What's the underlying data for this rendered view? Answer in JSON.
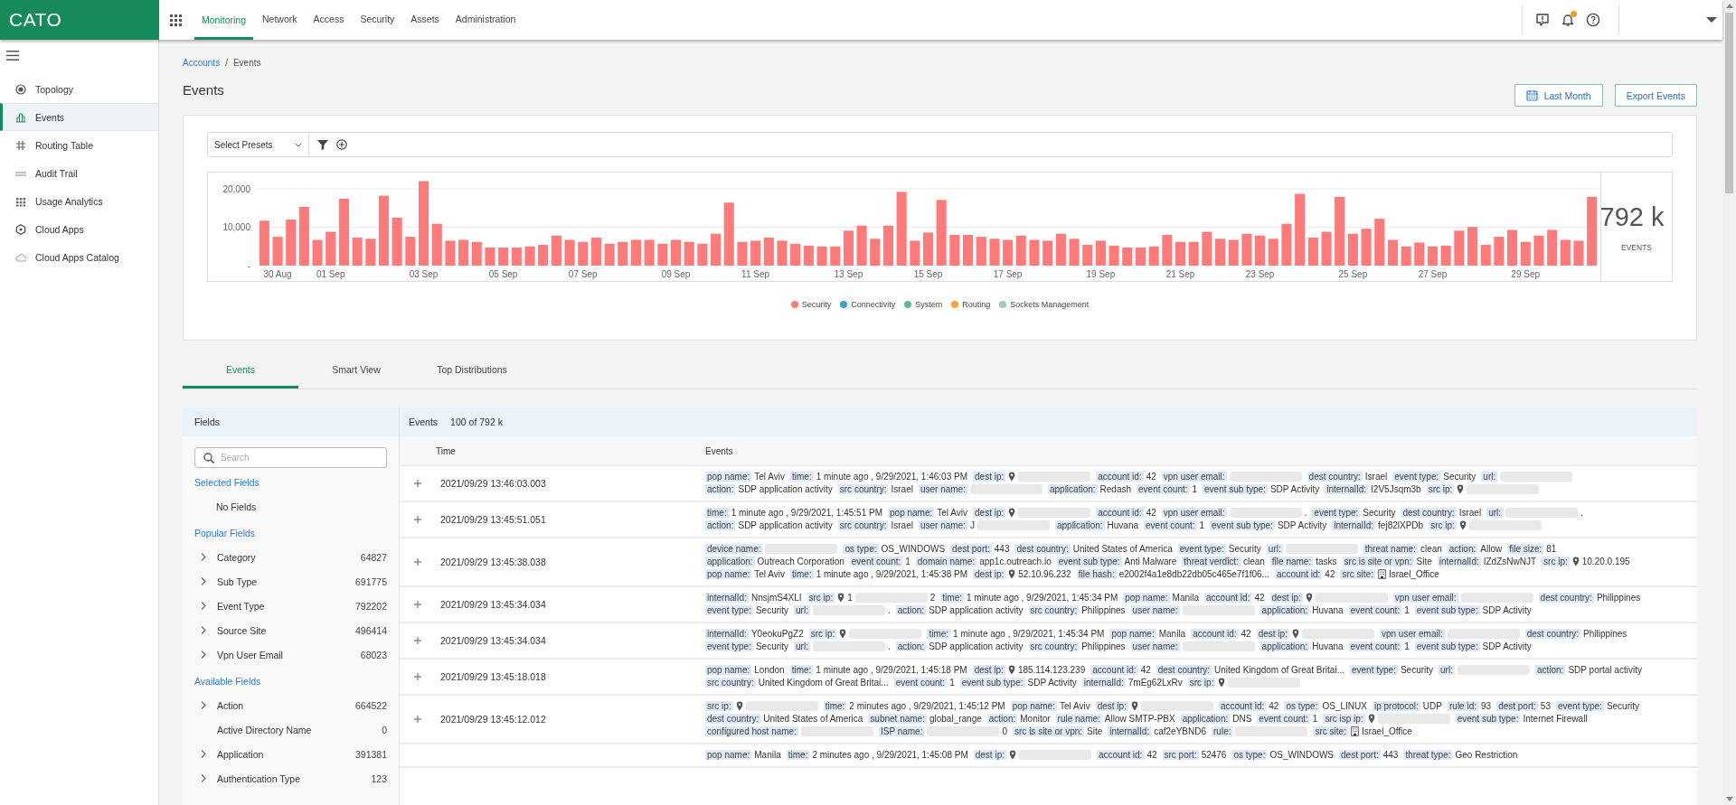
{
  "top_bar": {
    "logo": "CATO",
    "nav": [
      {
        "label": "Monitoring",
        "selected": true
      },
      {
        "label": "Network",
        "selected": false
      },
      {
        "label": "Access",
        "selected": false
      },
      {
        "label": "Security",
        "selected": false
      },
      {
        "label": "Assets",
        "selected": false
      },
      {
        "label": "Administration",
        "selected": false
      }
    ],
    "bell_unread": true
  },
  "sidebar": {
    "items": [
      {
        "label": "Topology",
        "kind": "topology",
        "selected": false
      },
      {
        "label": "Events",
        "kind": "events",
        "selected": true
      },
      {
        "label": "Routing Table",
        "kind": "routing",
        "selected": false
      },
      {
        "label": "Audit Trail",
        "kind": "audit",
        "selected": false
      },
      {
        "label": "Usage Analytics",
        "kind": "usage",
        "selected": false
      },
      {
        "label": "Cloud Apps",
        "kind": "apps",
        "selected": false
      },
      {
        "label": "Cloud Apps Catalog",
        "kind": "catalog",
        "selected": false
      }
    ]
  },
  "breadcrumb": {
    "separator": "/",
    "items": [
      {
        "label": "Accounts",
        "kind": "link"
      },
      {
        "label": "Events",
        "kind": "current"
      }
    ]
  },
  "page_title": "Events",
  "actions": [
    {
      "label": "Last Month",
      "kind": "date"
    },
    {
      "label": "Export Events",
      "kind": "plain"
    }
  ],
  "filter_bar": {
    "preset_select": "Select Presets"
  },
  "chart": {
    "total": "792 k",
    "total_label": "EVENTS",
    "legend_more": [
      {
        "label": "Connectivity",
        "color": "#3f9fcb"
      },
      {
        "label": "System",
        "color": "#5cb8a4"
      },
      {
        "label": "Routing",
        "color": "#f7a431"
      },
      {
        "label": "Sockets Management",
        "color": "#9fcbb8"
      }
    ],
    "chart_data": {
      "type": "bar",
      "categories": [
        null,
        "30 Aug",
        null,
        null,
        null,
        "01 Sep",
        null,
        null,
        null,
        null,
        null,
        null,
        "03 Sep",
        null,
        null,
        null,
        null,
        null,
        "05 Sep",
        null,
        null,
        null,
        null,
        null,
        "07 Sep",
        null,
        null,
        null,
        null,
        null,
        null,
        "09 Sep",
        null,
        null,
        null,
        null,
        null,
        "11 Sep",
        null,
        null,
        null,
        null,
        null,
        null,
        "13 Sep",
        null,
        null,
        null,
        null,
        null,
        "15 Sep",
        null,
        null,
        null,
        null,
        null,
        "17 Sep",
        null,
        null,
        null,
        null,
        null,
        null,
        "19 Sep",
        null,
        null,
        null,
        null,
        null,
        "21 Sep",
        null,
        null,
        null,
        null,
        null,
        "23 Sep",
        null,
        null,
        null,
        null,
        null,
        null,
        "25 Sep",
        null,
        null,
        null,
        null,
        null,
        "27 Sep",
        null,
        null,
        null,
        null,
        null,
        null,
        "29 Sep",
        null,
        null,
        null,
        null,
        null
      ],
      "series": [
        {
          "name": "Security",
          "color": "#ff7b7b",
          "values": [
            11700,
            7500,
            12000,
            15300,
            6700,
            8800,
            17400,
            7300,
            7000,
            18200,
            12500,
            7500,
            22000,
            10900,
            6500,
            6700,
            6200,
            4700,
            4700,
            4700,
            5000,
            5400,
            7800,
            6700,
            6200,
            7300,
            5700,
            6200,
            6700,
            6700,
            5700,
            6700,
            6200,
            5700,
            8300,
            16400,
            6200,
            6500,
            7300,
            6500,
            5700,
            5200,
            5000,
            5000,
            9100,
            10400,
            7000,
            10400,
            19200,
            6500,
            8600,
            17100,
            8000,
            8000,
            7500,
            7000,
            6700,
            7800,
            6700,
            6500,
            8300,
            7000,
            5400,
            6500,
            5200,
            4700,
            4700,
            5000,
            8000,
            6200,
            6200,
            8800,
            7000,
            6700,
            8300,
            7800,
            7000,
            10900,
            18700,
            7300,
            8800,
            17900,
            8300,
            9600,
            12200,
            6700,
            5000,
            6000,
            5000,
            5200,
            9100,
            10100,
            5400,
            7500,
            9300,
            6200,
            7800,
            9300,
            6700,
            6500,
            17900
          ]
        }
      ],
      "ylim": [
        0,
        22000
      ],
      "yticks": [
        {
          "value": 0,
          "label": "-"
        },
        {
          "value": 10000,
          "label": "10,000"
        },
        {
          "value": 20000,
          "label": "20,000"
        }
      ]
    }
  },
  "tabs": [
    {
      "label": "Events",
      "selected": true
    },
    {
      "label": "Smart View",
      "selected": false
    },
    {
      "label": "Top Distributions",
      "selected": false
    }
  ],
  "fields_panel": {
    "title": "Fields",
    "search": {
      "placeholder": "Search"
    },
    "sections": [
      {
        "title": "Selected Fields",
        "empty_text": "No Fields"
      },
      {
        "title": "Popular Fields",
        "items": [
          {
            "name": "Category",
            "count": "64827",
            "expandable": true
          },
          {
            "name": "Sub Type",
            "count": "691775",
            "expandable": true
          },
          {
            "name": "Event Type",
            "count": "792202",
            "expandable": true
          },
          {
            "name": "Source Site",
            "count": "496414",
            "expandable": true
          },
          {
            "name": "Vpn User Email",
            "count": "68023",
            "expandable": true
          }
        ]
      },
      {
        "title": "Available Fields",
        "items": [
          {
            "name": "Action",
            "count": "664522",
            "expandable": true
          },
          {
            "name": "Active Directory Name",
            "count": "0",
            "expandable": false
          },
          {
            "name": "Application",
            "count": "391381",
            "expandable": true
          },
          {
            "name": "Authentication Type",
            "count": "123",
            "expandable": true
          }
        ]
      }
    ]
  },
  "events_panel": {
    "title": "Events",
    "count": "100 of 792 k",
    "columns": [
      "Time",
      "Events"
    ],
    "rows": [
      {
        "time": "2021/09/29 13:46:03.003",
        "tags": [
          {
            "key": "pop name:",
            "kind": "text",
            "value": "Tel Aviv",
            "redacted": false
          },
          {
            "key": "time:",
            "kind": "text",
            "value": "1 minute ago , 9/29/2021, 1:46:03 PM",
            "redacted": false
          },
          {
            "key": "dest ip:",
            "kind": "location",
            "redacted": true
          },
          {
            "key": "account id:",
            "kind": "text",
            "value": "42",
            "redacted": false
          },
          {
            "key": "vpn user email:",
            "kind": "text",
            "redacted": true
          },
          {
            "key": "dest country:",
            "kind": "text",
            "value": "Israel",
            "redacted": false
          },
          {
            "key": "event type:",
            "kind": "text",
            "value": "Security",
            "redacted": false
          },
          {
            "key": "url:",
            "kind": "text",
            "redacted": true
          },
          {
            "key": "action:",
            "kind": "text",
            "value": "SDP application activity",
            "redacted": false
          },
          {
            "key": "src country:",
            "kind": "text",
            "value": "Israel",
            "redacted": false
          },
          {
            "key": "user name:",
            "kind": "text",
            "redacted": true
          },
          {
            "key": "application:",
            "kind": "text",
            "value": "Redash",
            "redacted": false
          },
          {
            "key": "event count:",
            "kind": "text",
            "value": "1",
            "redacted": false
          },
          {
            "key": "event sub type:",
            "kind": "text",
            "value": "SDP Activity",
            "redacted": false
          },
          {
            "key": "internalId:",
            "kind": "text",
            "value": "I2V5Jsqm3b",
            "redacted": false
          },
          {
            "key": "src ip:",
            "kind": "location",
            "redacted": true
          }
        ]
      },
      {
        "time": "2021/09/29 13:45:51.051",
        "tags": [
          {
            "key": "time:",
            "kind": "text",
            "value": "1 minute ago , 9/29/2021, 1:45:51 PM",
            "redacted": false
          },
          {
            "key": "pop name:",
            "kind": "text",
            "value": "Tel Aviv",
            "redacted": false
          },
          {
            "key": "dest ip:",
            "kind": "location",
            "redacted": true
          },
          {
            "key": "account id:",
            "kind": "text",
            "value": "42",
            "redacted": false
          },
          {
            "key": "vpn user email:",
            "kind": "text",
            "redacted": true,
            "tail": "."
          },
          {
            "key": "event type:",
            "kind": "text",
            "value": "Security",
            "redacted": false
          },
          {
            "key": "dest country:",
            "kind": "text",
            "value": "Israel",
            "redacted": false
          },
          {
            "key": "url:",
            "kind": "text",
            "redacted": true,
            "tail": "."
          },
          {
            "key": "action:",
            "kind": "text",
            "value": "SDP application activity",
            "redacted": false
          },
          {
            "key": "src country:",
            "kind": "text",
            "value": "Israel",
            "redacted": false
          },
          {
            "key": "user name:",
            "kind": "text",
            "value": "J",
            "redacted": true
          },
          {
            "key": "application:",
            "kind": "text",
            "value": "Huvana",
            "redacted": false
          },
          {
            "key": "event count:",
            "kind": "text",
            "value": "1",
            "redacted": false
          },
          {
            "key": "event sub type:",
            "kind": "text",
            "value": "SDP Activity",
            "redacted": false
          },
          {
            "key": "internalId:",
            "kind": "text",
            "value": "fej82lXPDb",
            "redacted": false
          },
          {
            "key": "src ip:",
            "kind": "location",
            "redacted": true
          }
        ]
      },
      {
        "time": "2021/09/29 13:45:38.038",
        "tags": [
          {
            "key": "device name:",
            "kind": "text",
            "redacted": true
          },
          {
            "key": "os type:",
            "kind": "text",
            "value": "OS_WINDOWS",
            "redacted": false
          },
          {
            "key": "dest port:",
            "kind": "text",
            "value": "443",
            "redacted": false
          },
          {
            "key": "dest country:",
            "kind": "text",
            "value": "United States of America",
            "redacted": false
          },
          {
            "key": "event type:",
            "kind": "text",
            "value": "Security",
            "redacted": false
          },
          {
            "key": "url:",
            "kind": "text",
            "redacted": true
          },
          {
            "key": "threat name:",
            "kind": "text",
            "value": "clean",
            "redacted": false
          },
          {
            "key": "action:",
            "kind": "text",
            "value": "Allow",
            "redacted": false
          },
          {
            "key": "file size:",
            "kind": "text",
            "value": "81",
            "redacted": false
          },
          {
            "key": "application:",
            "kind": "text",
            "value": "Outreach Corporation",
            "redacted": false
          },
          {
            "key": "event count:",
            "kind": "text",
            "value": "1",
            "redacted": false
          },
          {
            "key": "domain name:",
            "kind": "text",
            "value": "app1c.outreach.io",
            "redacted": false
          },
          {
            "key": "event sub type:",
            "kind": "text",
            "value": "Anti Malware",
            "redacted": false
          },
          {
            "key": "threat verdict:",
            "kind": "text",
            "value": "clean",
            "redacted": false
          },
          {
            "key": "file name:",
            "kind": "text",
            "value": "tasks",
            "redacted": false
          },
          {
            "key": "src is site or vpn:",
            "kind": "text",
            "value": "Site",
            "redacted": false
          },
          {
            "key": "internalId:",
            "kind": "text",
            "value": "IZdZsNwNJT",
            "redacted": false
          },
          {
            "key": "src ip:",
            "kind": "location",
            "value": "10.20.0.195",
            "redacted": false
          },
          {
            "key": "pop name:",
            "kind": "text",
            "value": "Tel Aviv",
            "redacted": false
          },
          {
            "key": "time:",
            "kind": "text",
            "value": "1 minute ago , 9/29/2021, 1:45:38 PM",
            "redacted": false
          },
          {
            "key": "dest ip:",
            "kind": "location",
            "value": "52.10.96.232",
            "redacted": false
          },
          {
            "key": "file hash:",
            "kind": "text",
            "value": "e2002f4a1e8db22db05c465e7f1f06...",
            "redacted": false
          },
          {
            "key": "account id:",
            "kind": "text",
            "value": "42",
            "redacted": false
          },
          {
            "key": "src site:",
            "kind": "site",
            "value": "Israel_Office",
            "redacted": false
          }
        ]
      },
      {
        "time": "2021/09/29 13:45:34.034",
        "tags": [
          {
            "key": "internalId:",
            "kind": "text",
            "value": "NnsjmS4XLI",
            "redacted": false
          },
          {
            "key": "src ip:",
            "kind": "location",
            "value": "1",
            "redacted": true,
            "tail": "2"
          },
          {
            "key": "time:",
            "kind": "text",
            "value": "1 minute ago , 9/29/2021, 1:45:34 PM",
            "redacted": false
          },
          {
            "key": "pop name:",
            "kind": "text",
            "value": "Manila",
            "redacted": false
          },
          {
            "key": "account id:",
            "kind": "text",
            "value": "42",
            "redacted": false
          },
          {
            "key": "dest ip:",
            "kind": "location",
            "redacted": true
          },
          {
            "key": "vpn user email:",
            "kind": "text",
            "redacted": true
          },
          {
            "key": "dest country:",
            "kind": "text",
            "value": "Philippines",
            "redacted": false
          },
          {
            "key": "event type:",
            "kind": "text",
            "value": "Security",
            "redacted": false
          },
          {
            "key": "url:",
            "kind": "text",
            "redacted": true,
            "tail": "."
          },
          {
            "key": "action:",
            "kind": "text",
            "value": "SDP application activity",
            "redacted": false
          },
          {
            "key": "src country:",
            "kind": "text",
            "value": "Philippines",
            "redacted": false
          },
          {
            "key": "user name:",
            "kind": "text",
            "redacted": true
          },
          {
            "key": "application:",
            "kind": "text",
            "value": "Huvana",
            "redacted": false
          },
          {
            "key": "event count:",
            "kind": "text",
            "value": "1",
            "redacted": false
          },
          {
            "key": "event sub type:",
            "kind": "text",
            "value": "SDP Activity",
            "redacted": false
          }
        ]
      },
      {
        "time": "2021/09/29 13:45:34.034",
        "tags": [
          {
            "key": "internalId:",
            "kind": "text",
            "value": "Y0eokuPgZ2",
            "redacted": false
          },
          {
            "key": "src ip:",
            "kind": "location",
            "redacted": true
          },
          {
            "key": "time:",
            "kind": "text",
            "value": "1 minute ago , 9/29/2021, 1:45:34 PM",
            "redacted": false
          },
          {
            "key": "pop name:",
            "kind": "text",
            "value": "Manila",
            "redacted": false
          },
          {
            "key": "account id:",
            "kind": "text",
            "value": "42",
            "redacted": false
          },
          {
            "key": "dest ip:",
            "kind": "location",
            "redacted": true
          },
          {
            "key": "vpn user email:",
            "kind": "text",
            "redacted": true
          },
          {
            "key": "dest country:",
            "kind": "text",
            "value": "Philippines",
            "redacted": false
          },
          {
            "key": "event type:",
            "kind": "text",
            "value": "Security",
            "redacted": false
          },
          {
            "key": "url:",
            "kind": "text",
            "redacted": true,
            "tail": "."
          },
          {
            "key": "action:",
            "kind": "text",
            "value": "SDP application activity",
            "redacted": false
          },
          {
            "key": "src country:",
            "kind": "text",
            "value": "Philippines",
            "redacted": false
          },
          {
            "key": "user name:",
            "kind": "text",
            "redacted": true
          },
          {
            "key": "application:",
            "kind": "text",
            "value": "Huvana",
            "redacted": false
          },
          {
            "key": "event count:",
            "kind": "text",
            "value": "1",
            "redacted": false
          },
          {
            "key": "event sub type:",
            "kind": "text",
            "value": "SDP Activity",
            "redacted": false
          }
        ]
      },
      {
        "time": "2021/09/29 13:45:18.018",
        "tags": [
          {
            "key": "pop name:",
            "kind": "text",
            "value": "London",
            "redacted": false
          },
          {
            "key": "time:",
            "kind": "text",
            "value": "1 minute ago , 9/29/2021, 1:45:18 PM",
            "redacted": false
          },
          {
            "key": "dest ip:",
            "kind": "location",
            "value": "185.114.123.239",
            "redacted": false
          },
          {
            "key": "account id:",
            "kind": "text",
            "value": "42",
            "redacted": false
          },
          {
            "key": "dest country:",
            "kind": "text",
            "value": "United Kingdom of Great Britai...",
            "redacted": false
          },
          {
            "key": "event type:",
            "kind": "text",
            "value": "Security",
            "redacted": false
          },
          {
            "key": "url:",
            "kind": "text",
            "redacted": true
          },
          {
            "key": "action:",
            "kind": "text",
            "value": "SDP portal activity",
            "redacted": false
          },
          {
            "key": "src country:",
            "kind": "text",
            "value": "United Kingdom of Great Britai...",
            "redacted": false
          },
          {
            "key": "event count:",
            "kind": "text",
            "value": "1",
            "redacted": false
          },
          {
            "key": "event sub type:",
            "kind": "text",
            "value": "SDP Activity",
            "redacted": false
          },
          {
            "key": "internalId:",
            "kind": "text",
            "value": "7mEg62LxRv",
            "redacted": false
          },
          {
            "key": "src ip:",
            "kind": "location",
            "redacted": true
          }
        ]
      },
      {
        "time": "2021/09/29 13:45:12.012",
        "tags": [
          {
            "key": "src ip:",
            "kind": "location",
            "redacted": true
          },
          {
            "key": "time:",
            "kind": "text",
            "value": "2 minutes ago , 9/29/2021, 1:45:12 PM",
            "redacted": false
          },
          {
            "key": "pop name:",
            "kind": "text",
            "value": "Tel Aviv",
            "redacted": false
          },
          {
            "key": "dest ip:",
            "kind": "location",
            "redacted": true
          },
          {
            "key": "account id:",
            "kind": "text",
            "value": "42",
            "redacted": false
          },
          {
            "key": "os type:",
            "kind": "text",
            "value": "OS_LINUX",
            "redacted": false
          },
          {
            "key": "ip protocol:",
            "kind": "text",
            "value": "UDP",
            "redacted": false
          },
          {
            "key": "rule id:",
            "kind": "text",
            "value": "93",
            "redacted": false
          },
          {
            "key": "dest port:",
            "kind": "text",
            "value": "53",
            "redacted": false
          },
          {
            "key": "event type:",
            "kind": "text",
            "value": "Security",
            "redacted": false
          },
          {
            "key": "dest country:",
            "kind": "text",
            "value": "United States of America",
            "redacted": false
          },
          {
            "key": "subnet name:",
            "kind": "text",
            "value": "global_range",
            "redacted": false
          },
          {
            "key": "action:",
            "kind": "text",
            "value": "Monitor",
            "redacted": false
          },
          {
            "key": "rule name:",
            "kind": "text",
            "value": "Allow SMTP-PBX",
            "redacted": false
          },
          {
            "key": "application:",
            "kind": "text",
            "value": "DNS",
            "redacted": false
          },
          {
            "key": "event count:",
            "kind": "text",
            "value": "1",
            "redacted": false
          },
          {
            "key": "src isp ip:",
            "kind": "location",
            "redacted": true
          },
          {
            "key": "event sub type:",
            "kind": "text",
            "value": "Internet Firewall",
            "redacted": false
          },
          {
            "key": "configured host name:",
            "kind": "text",
            "redacted": true
          },
          {
            "key": "ISP name:",
            "kind": "text",
            "redacted": true,
            "tail": "0"
          },
          {
            "key": "src is site or vpn:",
            "kind": "text",
            "value": "Site",
            "redacted": false
          },
          {
            "key": "internalId:",
            "kind": "text",
            "value": "caf2eYBND6",
            "redacted": false
          },
          {
            "key": "rule:",
            "kind": "text",
            "redacted": true
          },
          {
            "key": "src site:",
            "kind": "site",
            "value": "Israel_Office",
            "redacted": false
          }
        ]
      },
      {
        "tags": [
          {
            "key": "pop name:",
            "kind": "text",
            "value": "Manila",
            "redacted": false
          },
          {
            "key": "time:",
            "kind": "text",
            "value": "2 minutes ago , 9/29/2021, 1:45:08 PM",
            "redacted": false
          },
          {
            "key": "dest ip:",
            "kind": "location",
            "redacted": true
          },
          {
            "key": "account id:",
            "kind": "text",
            "value": "42",
            "redacted": false
          },
          {
            "key": "src port:",
            "kind": "text",
            "value": "52476",
            "redacted": false
          },
          {
            "key": "os type:",
            "kind": "text",
            "value": "OS_WINDOWS",
            "redacted": false
          },
          {
            "key": "dest port:",
            "kind": "text",
            "value": "443",
            "redacted": false
          },
          {
            "key": "threat type:",
            "kind": "text",
            "value": "Geo Restriction",
            "redacted": false
          }
        ]
      }
    ]
  }
}
